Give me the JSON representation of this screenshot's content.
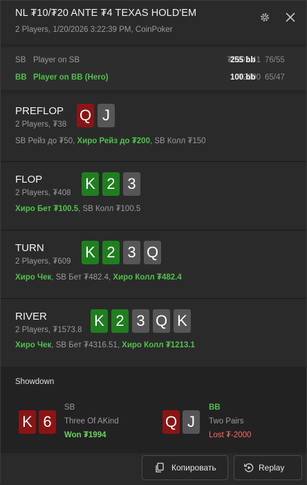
{
  "header": {
    "title": "NL ₮10/₮20 ANTE ₮4 TEXAS HOLD'EM",
    "subtitle": "2 Players, 1/20/2026 3:22:39 PM, CoinPoker",
    "settings_icon": "gear-icon",
    "close_icon": "close-icon"
  },
  "players": [
    {
      "pos": "SB",
      "name": "Player on SB",
      "stack": "₮5103.41",
      "bb": "255 bb",
      "ratio": "76/55"
    },
    {
      "pos": "BB",
      "name": "Player on BB (Hero)",
      "stack": "₮2000",
      "bb": "100 bb",
      "ratio": "65/47"
    }
  ],
  "streets": {
    "preflop": {
      "name": "PREFLOP",
      "meta": "2 Players, ₮38",
      "cards": [
        "Q",
        "J"
      ],
      "actions": [
        "SB Рейз до ₮50, ",
        "Хиро Рейз до ₮200",
        ", SB Колл ₮150"
      ]
    },
    "flop": {
      "name": "FLOP",
      "meta": "2 Players, ₮408",
      "cards": [
        "K",
        "2",
        "3"
      ],
      "actions": [
        "Хиро Бет ₮100.5",
        ", SB Колл ₮100.5"
      ]
    },
    "turn": {
      "name": "TURN",
      "meta": "2 Players, ₮609",
      "cards": [
        "K",
        "2",
        "3",
        "Q"
      ],
      "actions": [
        "Хиро Чек",
        ", SB Бет ₮482.4, ",
        "Хиро Колл ₮482.4"
      ]
    },
    "river": {
      "name": "RIVER",
      "meta": "2 Players, ₮1573.8",
      "cards": [
        "K",
        "2",
        "3",
        "Q",
        "K"
      ],
      "actions": [
        "Хиро Чек",
        ", SB Бет ₮4316.51, ",
        "Хиро Колл ₮1213.1"
      ]
    }
  },
  "showdown": {
    "title": "Showdown",
    "sb": {
      "cards": [
        "K",
        "6"
      ],
      "pos": "SB",
      "hand": "Three Of AKind",
      "result": "Won ₮1994"
    },
    "bb": {
      "cards": [
        "Q",
        "J"
      ],
      "pos": "BB",
      "hand": "Two Pairs",
      "result": "Lost ₮-2000"
    }
  },
  "footer": {
    "copy_label": "Копировать",
    "copy_icon": "copy-icon",
    "replay_label": "Replay",
    "replay_icon": "replay-icon"
  },
  "colors": {
    "hero_green": "#4fc34a",
    "heart_red": "#8b1414",
    "club_green": "#1f7f1f",
    "spade_gray": "#565656",
    "lost_red": "#ff6b5e"
  }
}
